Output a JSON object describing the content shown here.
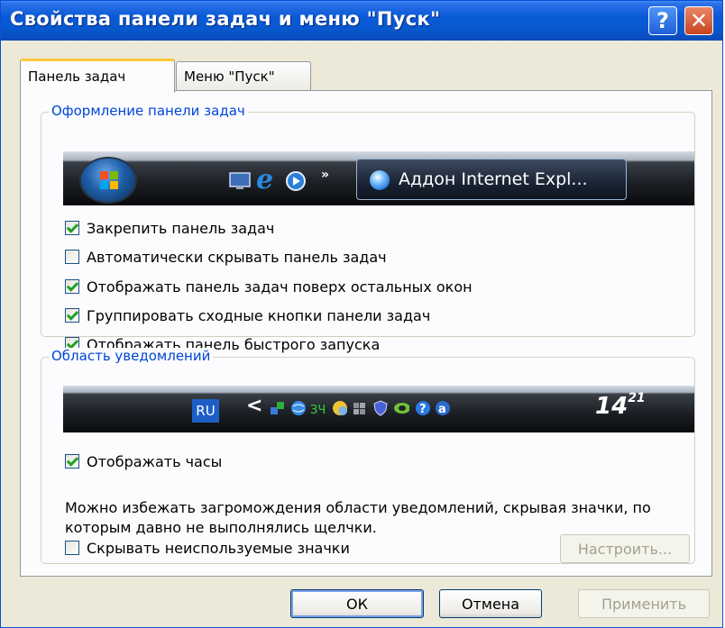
{
  "window": {
    "title": "Свойства панели задач и меню \"Пуск\"",
    "help_label": "?",
    "close_label": "✕"
  },
  "tabs": [
    {
      "label": "Панель задач",
      "active": true
    },
    {
      "label": "Меню \"Пуск\"",
      "active": false
    }
  ],
  "taskbar_group": {
    "title": "Оформление панели задач",
    "preview_task_label": "Аддон Internet Expl...",
    "quick_launch_overflow": "»",
    "options": [
      {
        "label": "Закрепить панель задач",
        "checked": true
      },
      {
        "label": "Автоматически скрывать панель задач",
        "checked": false
      },
      {
        "label": "Отображать панель задач поверх остальных окон",
        "checked": true
      },
      {
        "label": "Группировать сходные кнопки панели задач",
        "checked": true
      },
      {
        "label": "Отображать панель быстрого запуска",
        "checked": true
      }
    ]
  },
  "tray_group": {
    "title": "Область уведомлений",
    "lang": "RU",
    "expand_arrow": "<",
    "clock_hours": "14",
    "clock_minutes": "21",
    "show_clock": {
      "label": "Отображать часы",
      "checked": true
    },
    "description": "Можно избежать загромождения области уведомлений, скрывая значки, по которым давно не выполнялись щелчки.",
    "hide_inactive": {
      "label": "Скрывать неиспользуемые значки",
      "checked": false
    },
    "configure_label": "Настроить..."
  },
  "buttons": {
    "ok": "ОК",
    "cancel": "Отмена",
    "apply": "Применить"
  },
  "colors": {
    "titlebar": "#0858d0",
    "group_title": "#0046d5",
    "tab_highlight": "#ffc83c",
    "check": "#21a121"
  }
}
